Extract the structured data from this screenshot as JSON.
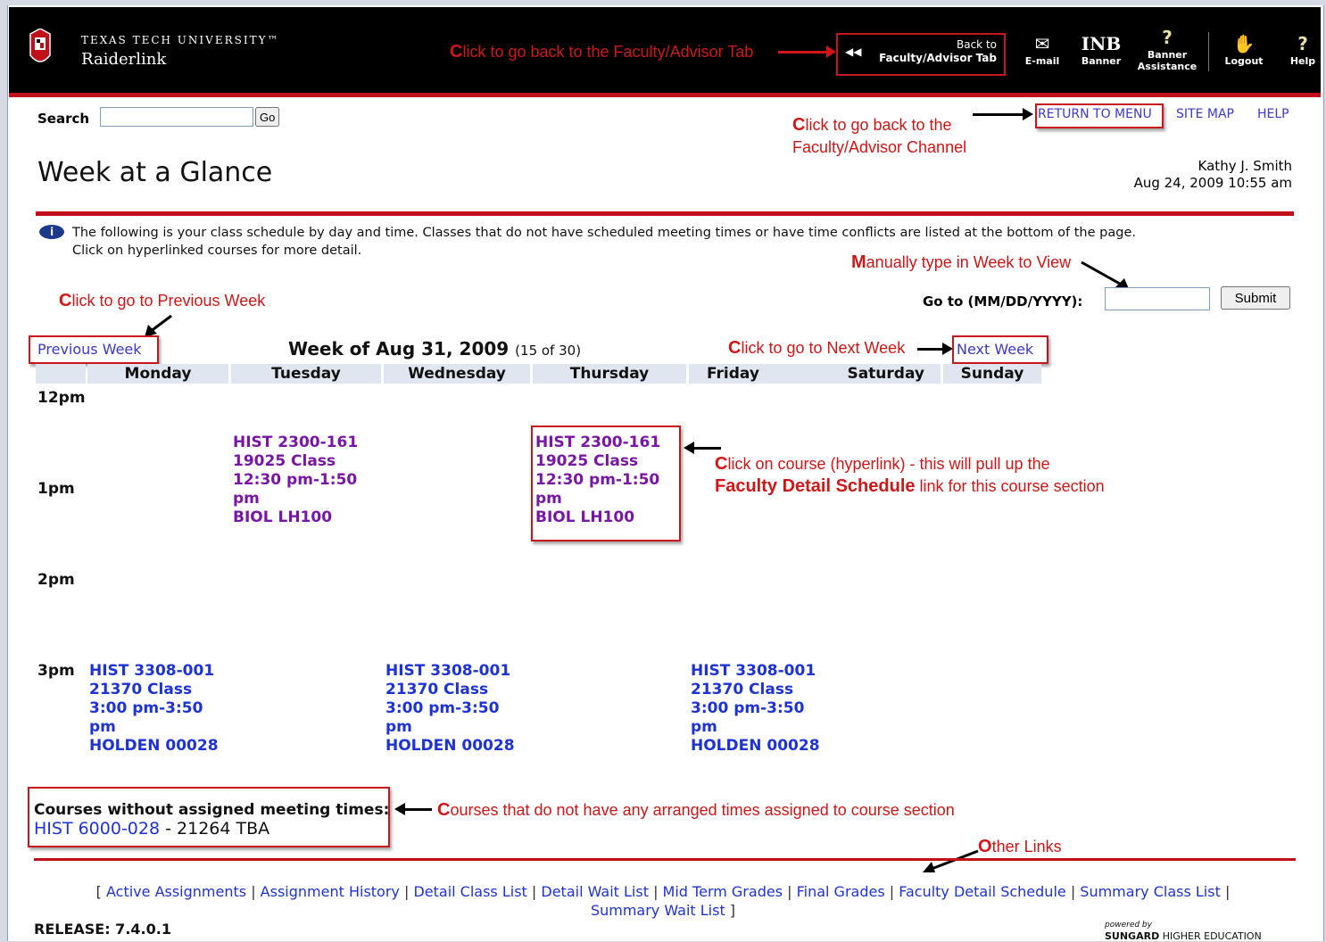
{
  "header": {
    "university": "TEXAS TECH UNIVERSITY™",
    "app": "Raiderlink",
    "back_line1": "Back to",
    "back_line2": "Faculty/Advisor Tab",
    "nav": [
      {
        "label": "E-mail",
        "icon": "envelope-icon"
      },
      {
        "label": "Banner",
        "icon": "inb-text",
        "icon_text": "INB"
      },
      {
        "label": "Banner Assistance",
        "icon": "question-icon"
      },
      {
        "label": "Logout",
        "icon": "hand-icon"
      },
      {
        "label": "Help",
        "icon": "question-icon"
      }
    ]
  },
  "search": {
    "label": "Search",
    "value": "",
    "button": "Go"
  },
  "toplinks": [
    "RETURN TO MENU",
    "SITE MAP",
    "HELP"
  ],
  "page": {
    "title": "Week at a Glance",
    "user": "Kathy J. Smith",
    "datetime": "Aug 24, 2009 10:55 am",
    "info": "The following is your class schedule by day and time. Classes that do not have scheduled meeting times or have time conflicts are listed at the bottom of the page.",
    "info2": "Click on hyperlinked courses for more detail."
  },
  "goto": {
    "label": "Go to (MM/DD/YYYY):",
    "value": "",
    "button": "Submit"
  },
  "week": {
    "prev": "Previous Week",
    "next": "Next Week",
    "title": "Week of Aug 31, 2009",
    "count": "(15 of 30)",
    "days": [
      "Monday",
      "Tuesday",
      "Wednesday",
      "Thursday",
      "Friday",
      "Saturday",
      "Sunday"
    ],
    "times": [
      "12pm",
      "1pm",
      "2pm",
      "3pm"
    ]
  },
  "courses": {
    "tue": {
      "l1": "HIST 2300-161",
      "l2": "19025 Class",
      "l3": "12:30 pm-1:50",
      "l4": "pm",
      "l5": "BIOL LH100"
    },
    "thu": {
      "l1": "HIST 2300-161",
      "l2": "19025 Class",
      "l3": "12:30 pm-1:50",
      "l4": "pm",
      "l5": "BIOL LH100"
    },
    "mon": {
      "l1": "HIST 3308-001",
      "l2": "21370 Class",
      "l3": "3:00 pm-3:50",
      "l4": "pm",
      "l5": "HOLDEN 00028"
    },
    "wed": {
      "l1": "HIST 3308-001",
      "l2": "21370 Class",
      "l3": "3:00 pm-3:50",
      "l4": "pm",
      "l5": "HOLDEN 00028"
    },
    "fri": {
      "l1": "HIST 3308-001",
      "l2": "21370 Class",
      "l3": "3:00 pm-3:50",
      "l4": "pm",
      "l5": "HOLDEN 00028"
    }
  },
  "unassigned": {
    "label": "Courses without assigned meeting times:",
    "course": "HIST 6000-028",
    "rest": " - 21264 TBA"
  },
  "annotations": {
    "back": {
      "first": "C",
      "rest": "lick to go back to the Faculty/Advisor Tab"
    },
    "menu1": {
      "first": "C",
      "rest": "lick to go back to the"
    },
    "menu2": "Faculty/Advisor Channel",
    "manual": {
      "first": "M",
      "rest": "anually type in Week to View"
    },
    "prev": {
      "first": "C",
      "rest": "lick to go to Previous Week"
    },
    "next": {
      "first": "C",
      "rest": "lick to go to Next Week"
    },
    "course1": {
      "first": "C",
      "rest": "lick on course (hyperlink) - this will pull up the"
    },
    "course2_bold": "Faculty Detail Schedule",
    "course2_rest": " link for this course section",
    "unassigned": {
      "first": "C",
      "rest": "ourses that do not have any arranged times assigned to course section"
    },
    "other": {
      "first": "O",
      "rest": "ther Links"
    }
  },
  "footer": {
    "links": [
      "Active Assignments",
      "Assignment History",
      "Detail Class List",
      "Detail Wait List",
      "Mid Term Grades",
      "Final Grades",
      "Faculty Detail Schedule",
      "Summary Class List",
      "Summary Wait List"
    ],
    "release": "RELEASE: 7.4.0.1",
    "powered": "powered by",
    "brand": "SUNGARD",
    "brand2": " HIGHER EDUCATION"
  },
  "colors": {
    "brand_red": "#c0101a",
    "annotation_red": "#d01616",
    "visited_purple": "#7a16a5",
    "link_blue": "#1d33d6"
  }
}
